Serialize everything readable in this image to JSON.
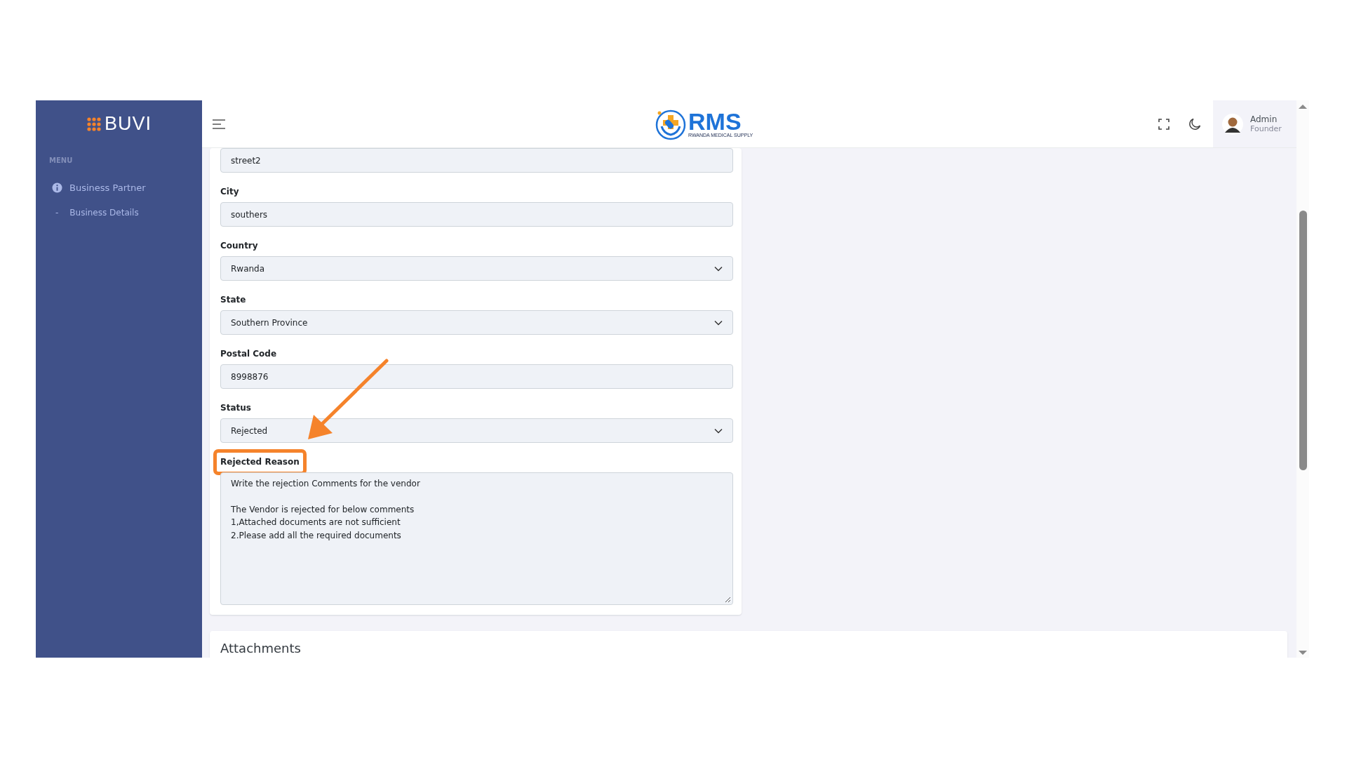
{
  "sidebar": {
    "logo": "BUVI",
    "menu_title": "MENU",
    "items": [
      {
        "label": "Business Partner",
        "kind": "info",
        "children": [
          {
            "bullet": "-",
            "label": "Business Details"
          }
        ]
      }
    ]
  },
  "header": {
    "logo_title": "RMS",
    "logo_subtitle": "RWANDA MEDICAL SUPPLY",
    "user": {
      "name": "Admin",
      "role": "Founder"
    }
  },
  "form": {
    "fields": [
      {
        "kind": "input",
        "value": "street2"
      },
      {
        "kind": "input",
        "label": "City",
        "value": "southers"
      },
      {
        "kind": "select",
        "label": "Country",
        "value": "Rwanda"
      },
      {
        "kind": "select",
        "label": "State",
        "value": "Southern Province"
      },
      {
        "kind": "input",
        "label": "Postal Code",
        "value": "8998876"
      },
      {
        "kind": "select",
        "label": "Status",
        "value": "Rejected"
      },
      {
        "kind": "textarea",
        "label": "Rejected Reason",
        "highlighted": true,
        "paragraphs": [
          "Write the rejection Comments for the vendor",
          "The Vendor is rejected for below comments\n1,Attached documents are not sufficient\n2.Please add all the required documents"
        ]
      }
    ]
  },
  "attachments": {
    "title": "Attachments"
  }
}
